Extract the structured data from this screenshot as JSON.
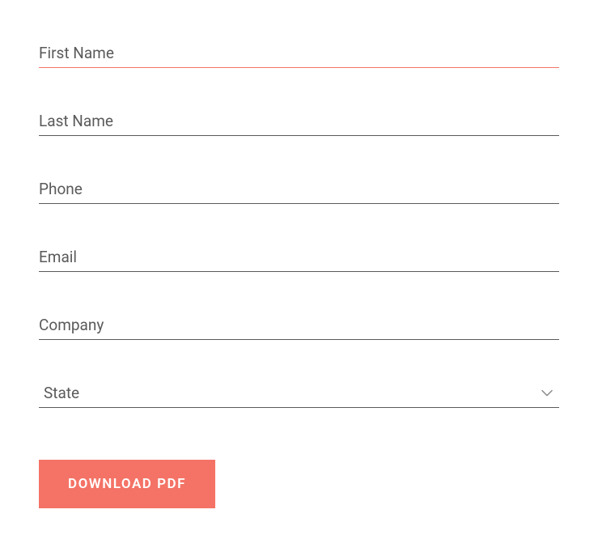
{
  "form": {
    "first_name": {
      "placeholder": "First Name",
      "value": ""
    },
    "last_name": {
      "placeholder": "Last Name",
      "value": ""
    },
    "phone": {
      "placeholder": "Phone",
      "value": ""
    },
    "email": {
      "placeholder": "Email",
      "value": ""
    },
    "company": {
      "placeholder": "Company",
      "value": ""
    },
    "state": {
      "label": "State",
      "selected": "State"
    },
    "submit_label": "DOWNLOAD PDF"
  },
  "colors": {
    "accent": "#f47366",
    "text": "#5a5a5a",
    "border": "#5a5a5a"
  }
}
